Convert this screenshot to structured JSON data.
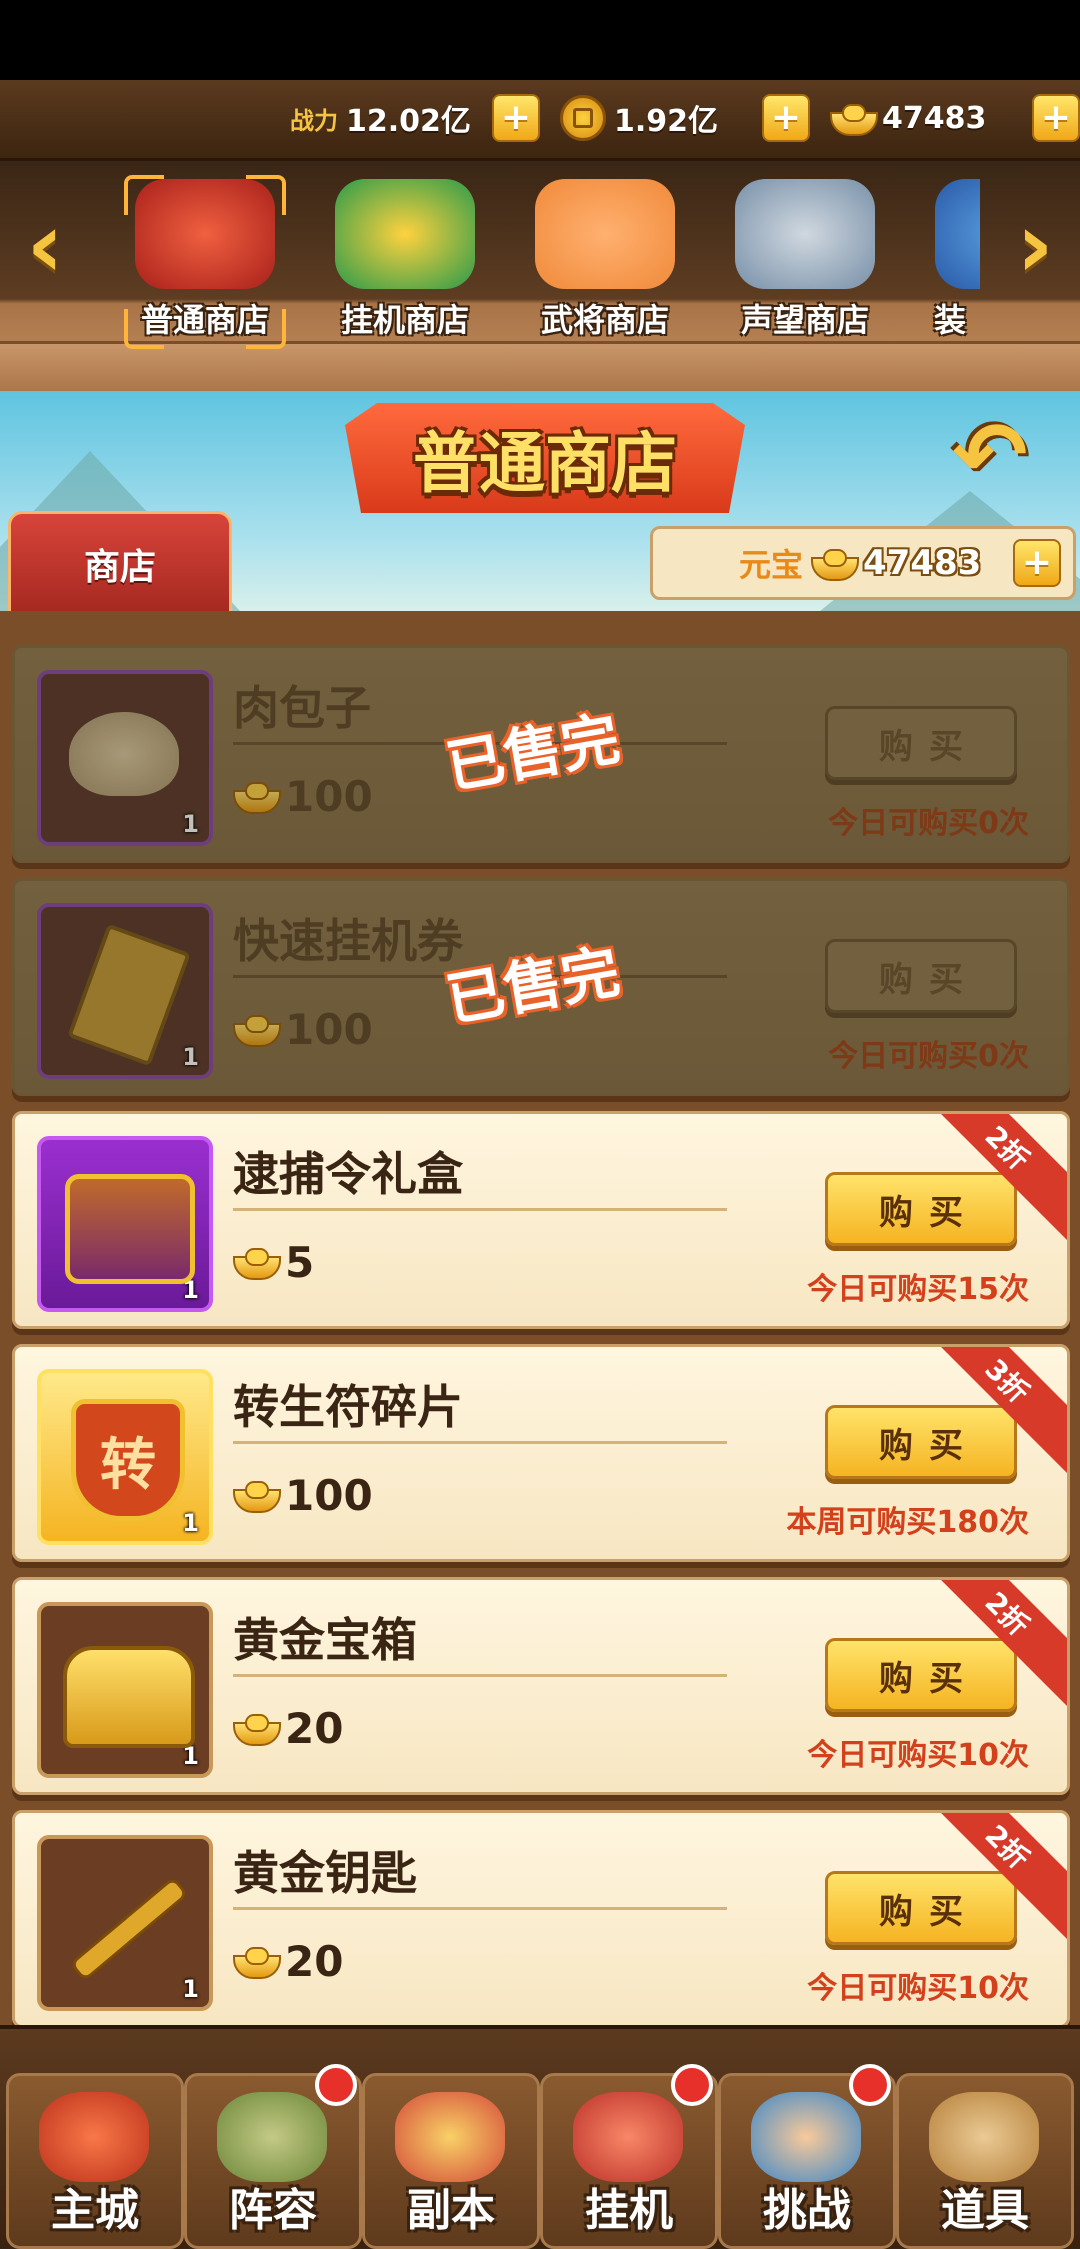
{
  "resources": {
    "power_label": "战力",
    "power_value": "12.02亿",
    "coins_value": "1.92亿",
    "ingots_value": "47483",
    "plus": "+"
  },
  "shop_tabs": [
    {
      "label": "普通商店",
      "selected": true
    },
    {
      "label": "挂机商店",
      "selected": false
    },
    {
      "label": "武将商店",
      "selected": false
    },
    {
      "label": "声望商店",
      "selected": false
    },
    {
      "label": "装",
      "selected": false
    }
  ],
  "nav_arrows": {
    "left": "‹",
    "right": "›"
  },
  "banner": {
    "title": "普通商店",
    "back": "↶",
    "shop_tag": "商店",
    "currency_label": "元宝",
    "currency_value": "47483",
    "plus": "+"
  },
  "items": [
    {
      "name": "肉包子",
      "price": "100",
      "count": "1",
      "buy": "购买",
      "limit": "今日可购买0次",
      "sold_out": true,
      "stamp": "已售完",
      "discount": "",
      "icon": "meat-bun-icon"
    },
    {
      "name": "快速挂机券",
      "price": "100",
      "count": "1",
      "buy": "购买",
      "limit": "今日可购买0次",
      "sold_out": true,
      "stamp": "已售完",
      "discount": "",
      "icon": "quick-idle-ticket-icon"
    },
    {
      "name": "逮捕令礼盒",
      "price": "5",
      "count": "1",
      "buy": "购买",
      "limit": "今日可购买15次",
      "sold_out": false,
      "stamp": "",
      "discount": "2折",
      "icon": "gift-box-icon"
    },
    {
      "name": "转生符碎片",
      "price": "100",
      "count": "1",
      "buy": "购买",
      "limit": "本周可购买180次",
      "sold_out": false,
      "stamp": "",
      "discount": "3折",
      "icon": "rebirth-token-icon"
    },
    {
      "name": "黄金宝箱",
      "price": "20",
      "count": "1",
      "buy": "购买",
      "limit": "今日可购买10次",
      "sold_out": false,
      "stamp": "",
      "discount": "2折",
      "icon": "gold-chest-icon"
    },
    {
      "name": "黄金钥匙",
      "price": "20",
      "count": "1",
      "buy": "购买",
      "limit": "今日可购买10次",
      "sold_out": false,
      "stamp": "",
      "discount": "2折",
      "icon": "gold-key-icon"
    }
  ],
  "bottom_nav": [
    {
      "label": "主城",
      "badge": false
    },
    {
      "label": "阵容",
      "badge": true
    },
    {
      "label": "副本",
      "badge": false
    },
    {
      "label": "挂机",
      "badge": true
    },
    {
      "label": "挑战",
      "badge": true
    },
    {
      "label": "道具",
      "badge": false
    }
  ],
  "colors": {
    "accent_gold": "#f5c542",
    "price_red": "#d2401c",
    "discount_ribbon": "#d83a2a",
    "badge_red": "#e8302a"
  }
}
